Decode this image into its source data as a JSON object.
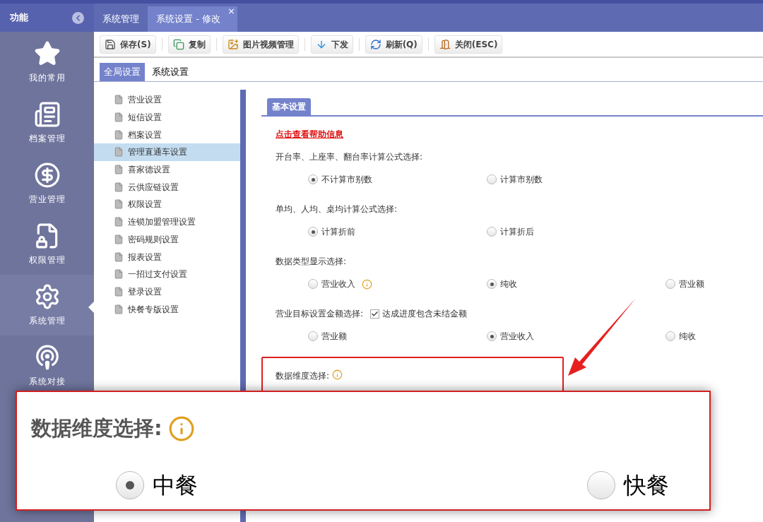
{
  "sidebar": {
    "header": "功能",
    "items": [
      {
        "label": "我的常用",
        "selected": false
      },
      {
        "label": "档案管理",
        "selected": false
      },
      {
        "label": "营业管理",
        "selected": false
      },
      {
        "label": "权限管理",
        "selected": false
      },
      {
        "label": "系统管理",
        "selected": true
      },
      {
        "label": "系统对接",
        "selected": false
      }
    ]
  },
  "tabs": [
    {
      "label": "系统管理",
      "selected": false,
      "closable": false
    },
    {
      "label": "系统设置 - 修改",
      "selected": true,
      "closable": true
    }
  ],
  "close_glyph": "×",
  "toolbar": [
    {
      "label": "保存(S)"
    },
    {
      "label": "复制"
    },
    {
      "label": "图片视频管理"
    },
    {
      "label": "下发"
    },
    {
      "label": "刷新(Q)"
    },
    {
      "label": "关闭(ESC)"
    }
  ],
  "subtabs": [
    {
      "label": "全局设置",
      "selected": true
    },
    {
      "label": "系统设置",
      "selected": false
    }
  ],
  "tree": [
    {
      "label": "营业设置",
      "selected": false
    },
    {
      "label": "短信设置",
      "selected": false
    },
    {
      "label": "档案设置",
      "selected": false
    },
    {
      "label": "管理直通车设置",
      "selected": true
    },
    {
      "label": "喜家德设置",
      "selected": false
    },
    {
      "label": "云供应链设置",
      "selected": false
    },
    {
      "label": "权限设置",
      "selected": false
    },
    {
      "label": "连锁加盟管理设置",
      "selected": false
    },
    {
      "label": "密码规则设置",
      "selected": false
    },
    {
      "label": "报表设置",
      "selected": false
    },
    {
      "label": "一招过支付设置",
      "selected": false
    },
    {
      "label": "登录设置",
      "selected": false
    },
    {
      "label": "快餐专版设置",
      "selected": false
    }
  ],
  "panel": {
    "tab": "基本设置",
    "help_link": "点击查看帮助信息",
    "groups": [
      {
        "label": "开台率、上座率、翻台率计算公式选择:",
        "options": [
          {
            "label": "不计算市别数",
            "selected": true
          },
          {
            "label": "计算市别数",
            "selected": false
          }
        ]
      },
      {
        "label": "单均、人均、桌均计算公式选择:",
        "options": [
          {
            "label": "计算折前",
            "selected": true
          },
          {
            "label": "计算折后",
            "selected": false
          }
        ]
      },
      {
        "label": "数据类型显示选择:",
        "options": [
          {
            "label": "营业收入",
            "selected": false,
            "info": true
          },
          {
            "label": "纯收",
            "selected": true
          },
          {
            "label": "营业额",
            "selected": false
          }
        ]
      },
      {
        "label": "营业目标设置金额选择:",
        "checkbox": {
          "label": "达成进度包含未结金额",
          "checked": true
        },
        "options": [
          {
            "label": "营业额",
            "selected": false
          },
          {
            "label": "营业收入",
            "selected": true
          },
          {
            "label": "纯收",
            "selected": false
          }
        ]
      }
    ],
    "highlighted": {
      "label": "数据维度选择:",
      "info": true
    }
  },
  "zoom_callout": {
    "label": "数据维度选择:",
    "info": true,
    "options": [
      {
        "label": "中餐",
        "selected": true
      },
      {
        "label": "快餐",
        "selected": false
      }
    ]
  }
}
